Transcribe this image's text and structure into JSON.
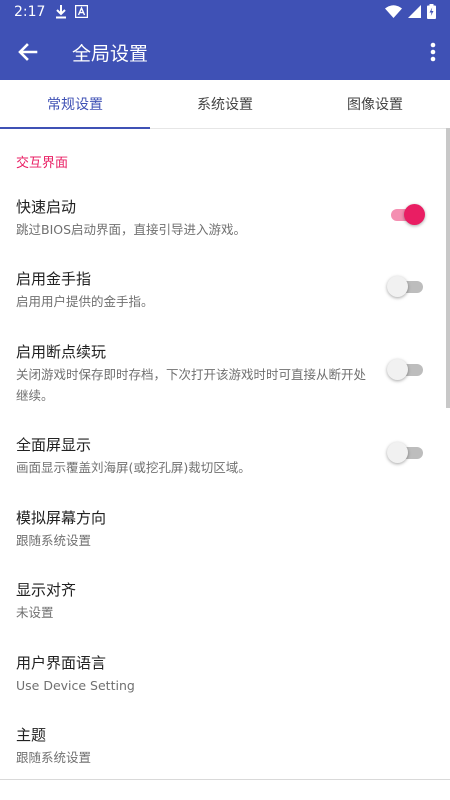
{
  "status_bar": {
    "time": "2:17",
    "left_icons": [
      "download-icon",
      "notification-a-icon"
    ],
    "right_icons": [
      "wifi-icon",
      "signal-icon",
      "battery-charging-icon"
    ]
  },
  "app_bar": {
    "title": "全局设置",
    "background": "#3f51b5"
  },
  "tabs": [
    {
      "label": "常规设置",
      "active": true
    },
    {
      "label": "系统设置",
      "active": false
    },
    {
      "label": "图像设置",
      "active": false
    }
  ],
  "section": {
    "header": "交互界面",
    "accent": "#e91e63"
  },
  "prefs": [
    {
      "title": "快速启动",
      "summary": "跳过BIOS启动界面，直接引导进入游戏。",
      "switch": true,
      "on": true
    },
    {
      "title": "启用金手指",
      "summary": "启用用户提供的金手指。",
      "switch": true,
      "on": false
    },
    {
      "title": "启用断点续玩",
      "summary": "关闭游戏时保存即时存档，下次打开该游戏时时可直接从断开处继续。",
      "switch": true,
      "on": false
    },
    {
      "title": "全面屏显示",
      "summary": "画面显示覆盖刘海屏(或挖孔屏)裁切区域。",
      "switch": true,
      "on": false
    },
    {
      "title": "模拟屏幕方向",
      "summary": "跟随系统设置",
      "switch": false
    },
    {
      "title": "显示对齐",
      "summary": "未设置",
      "switch": false
    },
    {
      "title": "用户界面语言",
      "summary": "Use Device Setting",
      "switch": false
    },
    {
      "title": "主题",
      "summary": "跟随系统设置",
      "switch": false
    }
  ]
}
